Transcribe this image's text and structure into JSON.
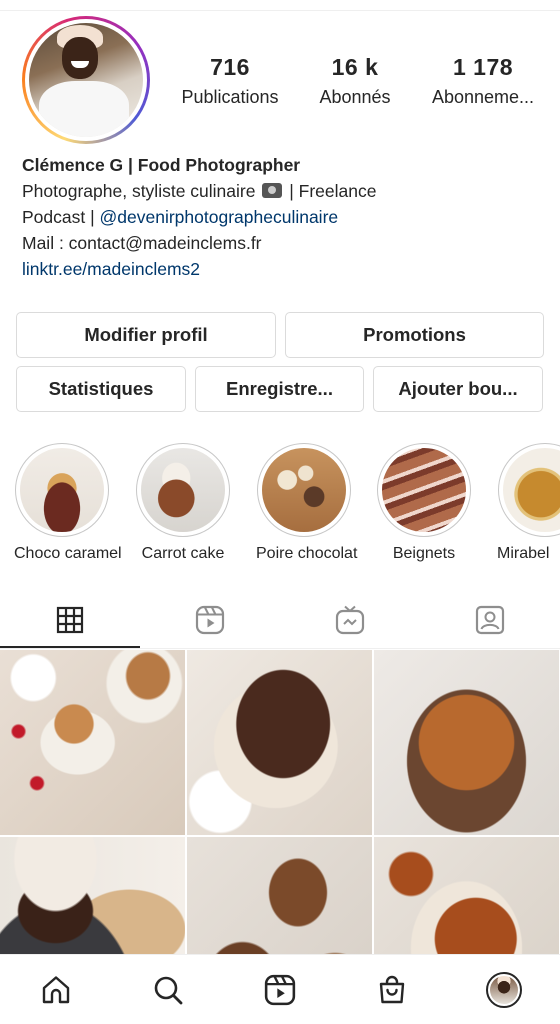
{
  "profile": {
    "stats": [
      {
        "value": "716",
        "label": "Publications"
      },
      {
        "value": "16 k",
        "label": "Abonnés"
      },
      {
        "value": "1 178",
        "label": "Abonneme..."
      }
    ],
    "name": "Clémence G | Food Photographer",
    "bio_line1_a": "Photographe, styliste culinaire",
    "bio_line1_b": "| Freelance",
    "bio_line2_a": "Podcast |",
    "bio_mention": "@devenirphotographeculinaire",
    "bio_line3": "Mail : contact@madeinclems.fr",
    "bio_link": "linktr.ee/madeinclems2"
  },
  "buttons": {
    "edit": "Modifier profil",
    "promotions": "Promotions",
    "stats": "Statistiques",
    "saved": "Enregistre...",
    "add": "Ajouter bou..."
  },
  "highlights": [
    {
      "label": "Choco caramel"
    },
    {
      "label": "Carrot cake"
    },
    {
      "label": "Poire chocolat"
    },
    {
      "label": "Beignets"
    },
    {
      "label": "Mirabel"
    }
  ],
  "tabs": [
    {
      "icon": "grid-icon",
      "active": true
    },
    {
      "icon": "reels-icon",
      "active": false
    },
    {
      "icon": "igtv-icon",
      "active": false
    },
    {
      "icon": "tagged-icon",
      "active": false
    }
  ],
  "bottom_nav": [
    "home-icon",
    "search-icon",
    "reels-icon",
    "shop-icon",
    "profile-avatar"
  ],
  "colors": {
    "text": "#262626",
    "link": "#00376b",
    "border": "#dbdbdb"
  }
}
